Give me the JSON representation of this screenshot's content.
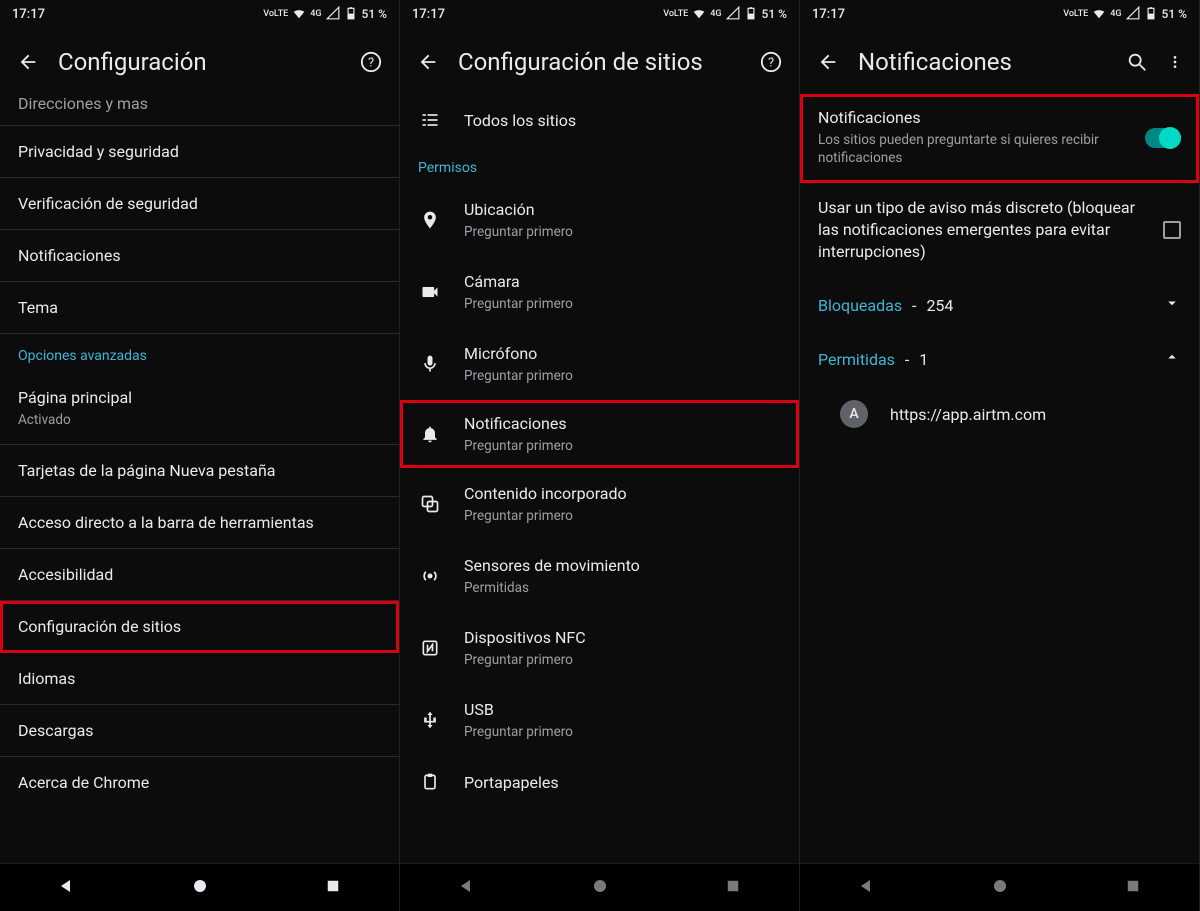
{
  "status": {
    "time": "17:17",
    "volte": "VoLTE",
    "network": "4G",
    "battery": "51 %"
  },
  "screen1": {
    "title": "Configuración",
    "cropped_top": "Direcciones y mas",
    "items": [
      {
        "label": "Privacidad y seguridad"
      },
      {
        "label": "Verificación de seguridad"
      },
      {
        "label": "Notificaciones"
      },
      {
        "label": "Tema"
      }
    ],
    "section": "Opciones avanzadas",
    "advanced": [
      {
        "label": "Página principal",
        "sub": "Activado"
      },
      {
        "label": "Tarjetas de la página Nueva pestaña"
      },
      {
        "label": "Acceso directo a la barra de herramientas"
      },
      {
        "label": "Accesibilidad"
      },
      {
        "label": "Configuración de sitios",
        "highlight": true
      },
      {
        "label": "Idiomas"
      },
      {
        "label": "Descargas"
      },
      {
        "label": "Acerca de Chrome"
      }
    ]
  },
  "screen2": {
    "title": "Configuración de sitios",
    "all_sites": "Todos los sitios",
    "section": "Permisos",
    "perms": [
      {
        "icon": "location",
        "label": "Ubicación",
        "sub": "Preguntar primero"
      },
      {
        "icon": "camera",
        "label": "Cámara",
        "sub": "Preguntar primero"
      },
      {
        "icon": "mic",
        "label": "Micrófono",
        "sub": "Preguntar primero"
      },
      {
        "icon": "bell",
        "label": "Notificaciones",
        "sub": "Preguntar primero",
        "highlight": true
      },
      {
        "icon": "embed",
        "label": "Contenido incorporado",
        "sub": "Preguntar primero"
      },
      {
        "icon": "sensor",
        "label": "Sensores de movimiento",
        "sub": "Permitidas"
      },
      {
        "icon": "nfc",
        "label": "Dispositivos NFC",
        "sub": "Preguntar primero"
      },
      {
        "icon": "usb",
        "label": "USB",
        "sub": "Preguntar primero"
      },
      {
        "icon": "clipboard",
        "label": "Portapapeles",
        "sub": ""
      }
    ]
  },
  "screen3": {
    "title": "Notificaciones",
    "block1": {
      "label": "Notificaciones",
      "sub": "Los sitios pueden preguntarte si quieres recibir notificaciones"
    },
    "block2": {
      "label": "Usar un tipo de aviso más discreto (bloquear las notificaciones emergentes para evitar interrupciones)"
    },
    "blocked": {
      "label": "Bloqueadas",
      "count": "254"
    },
    "allowed": {
      "label": "Permitidas",
      "count": "1"
    },
    "sites": [
      {
        "initial": "A",
        "url": "https://app.airtm.com"
      }
    ]
  }
}
